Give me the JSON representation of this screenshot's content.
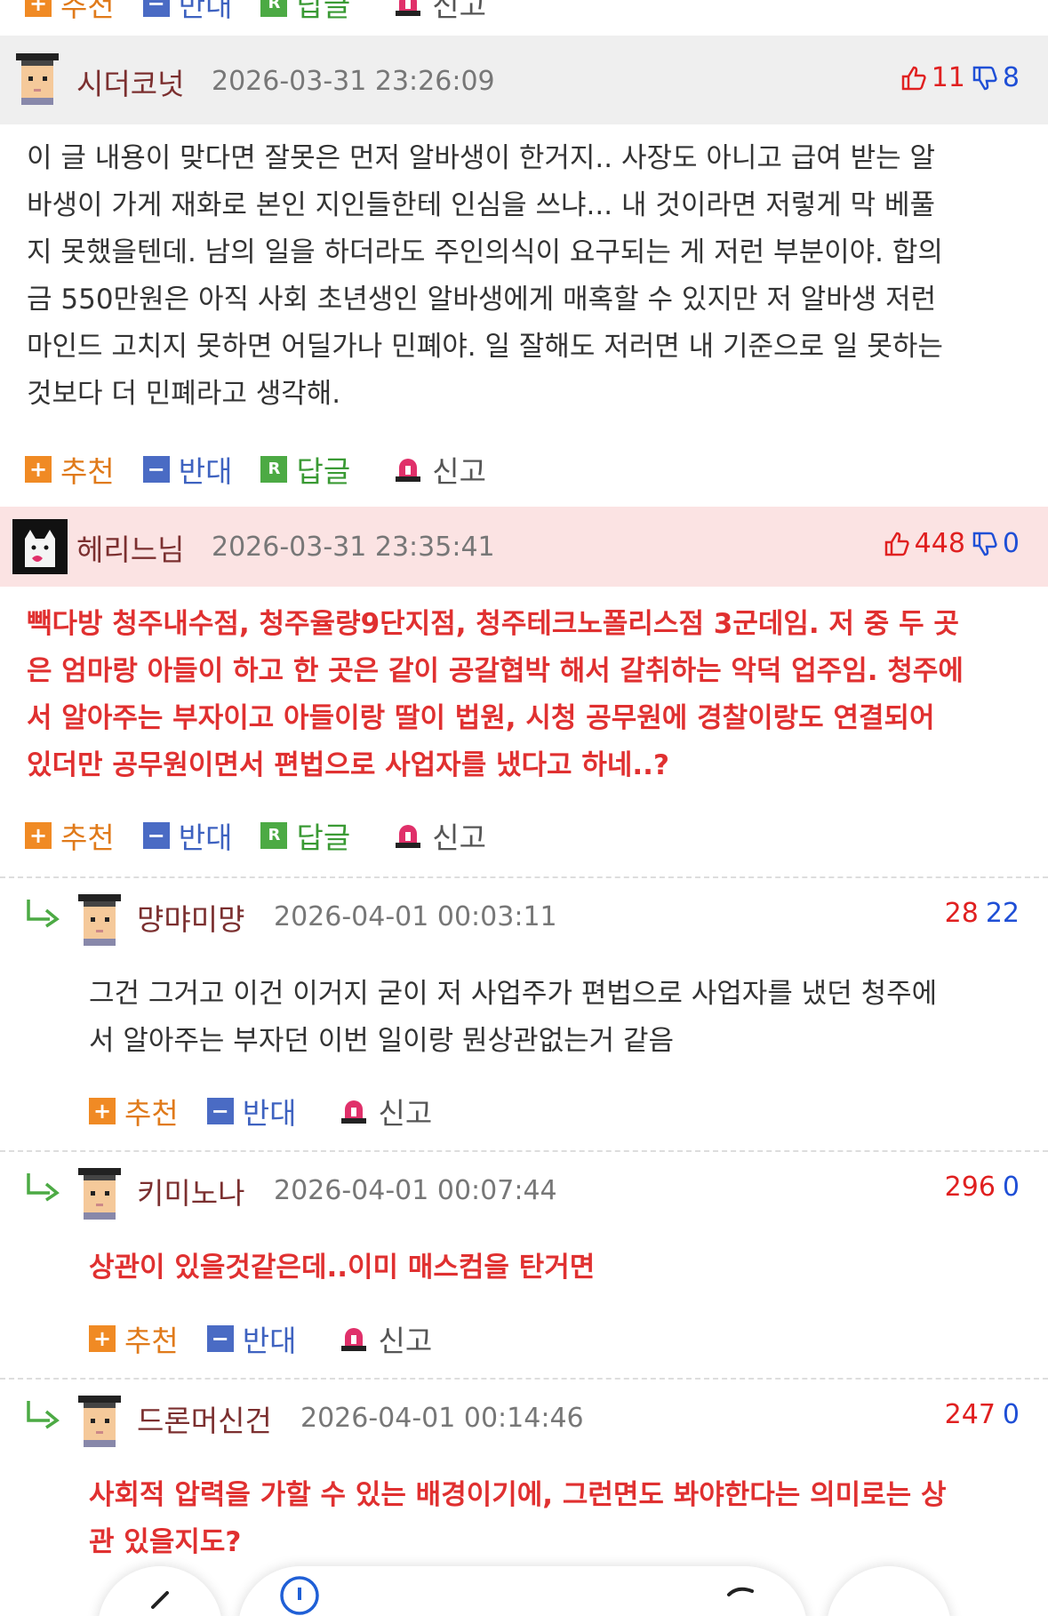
{
  "actions": {
    "recommend": "추천",
    "oppose": "반대",
    "reply": "답글",
    "report": "신고"
  },
  "comments": [
    {
      "nick": "시더코넛",
      "date": "2026-03-31 23:26:09",
      "up": "11",
      "down": "8",
      "lines": [
        "이 글 내용이 맞다면 잘못은 먼저 알바생이 한거지.. 사장도 아니고 급여 받는 알",
        "바생이 가게 재화로 본인 지인들한테 인심을 쓰냐... 내 것이라면 저렇게 막 베풀",
        "지 못했을텐데. 남의 일을 하더라도 주인의식이 요구되는 게 저런 부분이야. 합의",
        "금 550만원은 아직 사회 초년생인 알바생에게 매혹할 수 있지만 저 알바생 저런",
        "마인드 고치지 못하면 어딜가나 민폐야. 일 잘해도 저러면 내 기준으로 일 못하는",
        "것보다 더 민폐라고 생각해."
      ]
    },
    {
      "nick": "헤리느님",
      "date": "2026-03-31 23:35:41",
      "up": "448",
      "down": "0",
      "lines": [
        "빽다방 청주내수점, 청주율량9단지점, 청주테크노폴리스점 3군데임. 저 중 두 곳",
        "은 엄마랑 아들이 하고 한 곳은 같이 공갈협박 해서 갈취하는 악덕 업주임. 청주에",
        "서 알아주는 부자이고 아들이랑 딸이 법원, 시청 공무원에 경찰이랑도 연결되어",
        "있더만 공무원이면서 편법으로 사업자를 냈다고 하네..?"
      ]
    },
    {
      "nick": "먕먀미먕",
      "date": "2026-04-01 00:03:11",
      "up": "28",
      "down": "22",
      "lines": [
        "그건 그거고 이건 이거지 굳이 저 사업주가 편법으로 사업자를 냈던 청주에",
        "서 알아주는 부자던 이번 일이랑 뭔상관없는거 같음"
      ]
    },
    {
      "nick": "키미노나",
      "date": "2026-04-01 00:07:44",
      "up": "296",
      "down": "0",
      "lines": [
        "상관이 있을것같은데..이미 매스컴을 탄거면"
      ]
    },
    {
      "nick": "드론머신건",
      "date": "2026-04-01 00:14:46",
      "up": "247",
      "down": "0",
      "lines": [
        "사회적 압력을 가할 수 있는 배경이기에, 그런면도 봐야한다는 의미로는 상",
        "관 있을지도?"
      ]
    }
  ],
  "colors": {
    "red": "#e03030",
    "blue": "#1f4fd6",
    "nick": "#7b2f2f",
    "best_bg": "#fbe3e3",
    "header_bg": "#efefef"
  },
  "icons": [
    "plus-icon",
    "minus-icon",
    "reply-icon",
    "report-icon",
    "thumbs-up-icon",
    "thumbs-down-icon",
    "reply-arrow-icon",
    "back-icon",
    "forward-icon",
    "info-icon"
  ]
}
